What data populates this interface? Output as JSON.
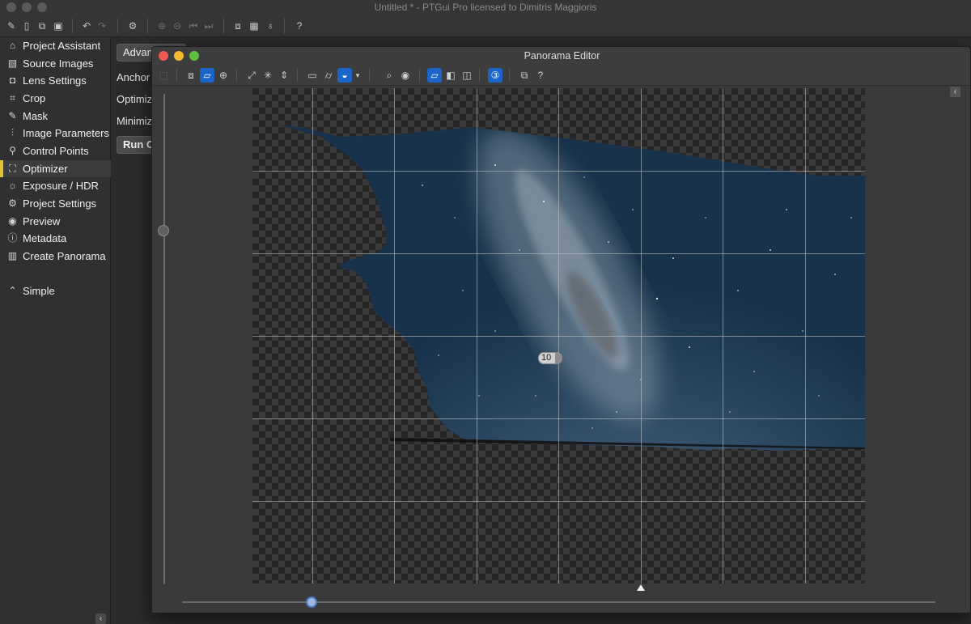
{
  "window": {
    "title": "Untitled * - PTGui Pro licensed to Dimitris Maggioris"
  },
  "toolbar": {
    "icons": [
      "new-project-icon",
      "open-icon",
      "duplicate-icon",
      "save-icon",
      "undo-icon",
      "redo-icon",
      "settings-icon",
      "zoom-in-icon",
      "zoom-out-icon",
      "previous-icon",
      "next-icon",
      "panorama-editor-icon",
      "table-icon",
      "lightbulb-icon",
      "help-icon"
    ]
  },
  "sidebar": {
    "items": [
      {
        "label": "Project Assistant",
        "icon": "home-icon",
        "glyph": "⌂"
      },
      {
        "label": "Source Images",
        "icon": "images-icon",
        "glyph": "▧"
      },
      {
        "label": "Lens Settings",
        "icon": "camera-icon",
        "glyph": "◘"
      },
      {
        "label": "Crop",
        "icon": "crop-icon",
        "glyph": "⌗"
      },
      {
        "label": "Mask",
        "icon": "brush-icon",
        "glyph": "✎"
      },
      {
        "label": "Image Parameters",
        "icon": "sliders-icon",
        "glyph": "⫶"
      },
      {
        "label": "Control Points",
        "icon": "control-points-icon",
        "glyph": "⚲"
      },
      {
        "label": "Optimizer",
        "icon": "optimizer-icon",
        "glyph": "⛶",
        "active": true
      },
      {
        "label": "Exposure / HDR",
        "icon": "sun-icon",
        "glyph": "☼"
      },
      {
        "label": "Project Settings",
        "icon": "gear-icon",
        "glyph": "⚙"
      },
      {
        "label": "Preview",
        "icon": "eye-icon",
        "glyph": "◉"
      },
      {
        "label": "Metadata",
        "icon": "info-icon",
        "glyph": "ⓘ"
      },
      {
        "label": "Create Panorama",
        "icon": "panorama-icon",
        "glyph": "▥"
      }
    ],
    "mode": {
      "label": "Simple",
      "icon": "chevron-up-circle-icon",
      "glyph": "⌃"
    }
  },
  "optimizer": {
    "advanced_button": "Advanced",
    "anchor_label": "Anchor",
    "optimize_label": "Optimize",
    "minimize_label": "Minimize",
    "run_button": "Run Optimizer"
  },
  "editor": {
    "title": "Panorama Editor",
    "image_number": "10",
    "colors": {
      "active_tool": "#1b64c8",
      "active_sidebar_marker": "#e0c532"
    }
  }
}
